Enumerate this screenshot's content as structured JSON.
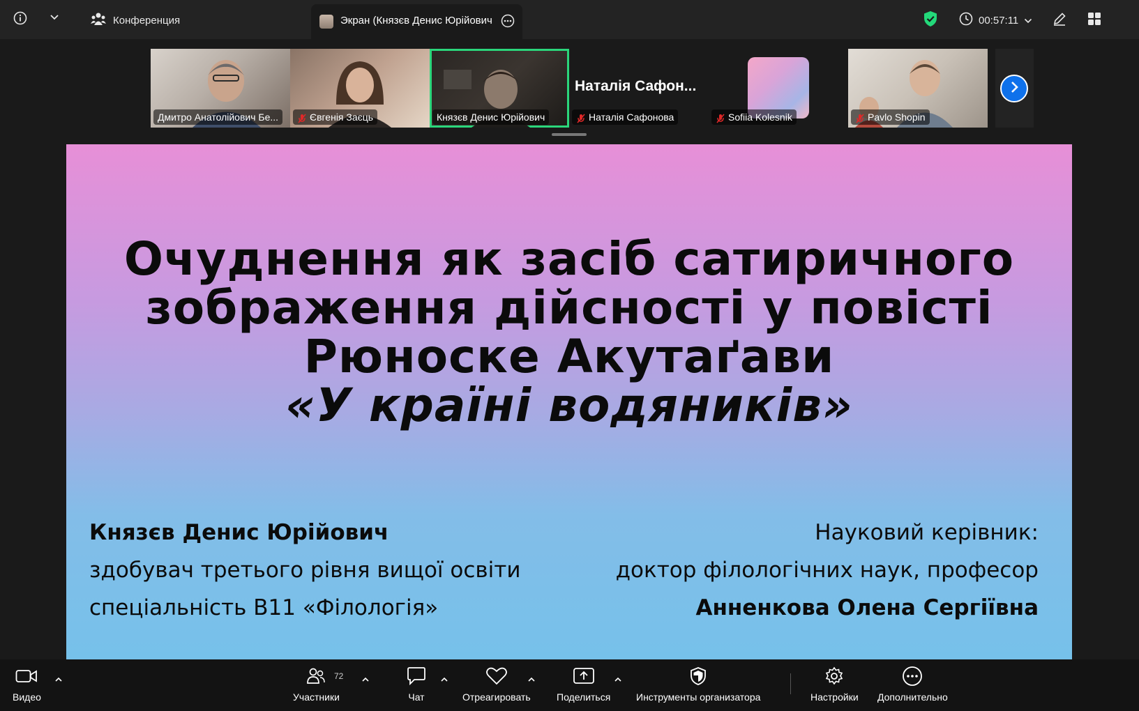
{
  "topbar": {
    "conference_label": "Конференция",
    "screen_tab_label": "Экран (Князєв Денис Юрійович",
    "timer": "00:57:11",
    "icons": [
      "info-icon",
      "chevron-down-icon",
      "participants-icon",
      "more-icon",
      "shield-icon",
      "clock-icon",
      "pen-icon",
      "grid-icon"
    ],
    "shield_color": "#23d97a"
  },
  "participants": [
    {
      "name": "Дмитро Анатолійович Бе...",
      "muted": false,
      "video": true,
      "active": false
    },
    {
      "name": "Євгенія Заєць",
      "muted": true,
      "video": true,
      "active": false
    },
    {
      "name": "Князєв Денис Юрійович",
      "muted": false,
      "video": true,
      "active": true
    },
    {
      "name": "Наталія Сафонова",
      "big_name": "Наталія Сафон...",
      "muted": true,
      "video": false,
      "active": false
    },
    {
      "name": "Sofiia Kolesnik",
      "muted": true,
      "video": false,
      "active": false
    },
    {
      "name": "Pavlo Shopin",
      "muted": true,
      "video": true,
      "active": false
    }
  ],
  "slide": {
    "title_lines": [
      "Очуднення як засіб сатиричного",
      "зображення дійсності у повісті",
      "Рюноске Акутаґави"
    ],
    "title_italic": "«У країні водяників»",
    "author_name": "Князєв Денис Юрійович",
    "author_line2": "здобувач третього рівня вищої освіти",
    "author_line3": "спеціальність В11 «Філологія»",
    "advisor_label": "Науковий керівник:",
    "advisor_degree": "доктор філологічних наук, професор",
    "advisor_name": "Анненкова Олена Сергіївна"
  },
  "toolbar": {
    "video": "Видео",
    "participants": "Участники",
    "participants_count": "72",
    "chat": "Чат",
    "react": "Отреагировать",
    "share": "Поделиться",
    "host_tools": "Инструменты организатора",
    "settings": "Настройки",
    "more": "Дополнительно"
  },
  "colors": {
    "active_speaker_border": "#2bd67b",
    "next_button": "#0e71eb",
    "mute_icon": "#e02828"
  }
}
